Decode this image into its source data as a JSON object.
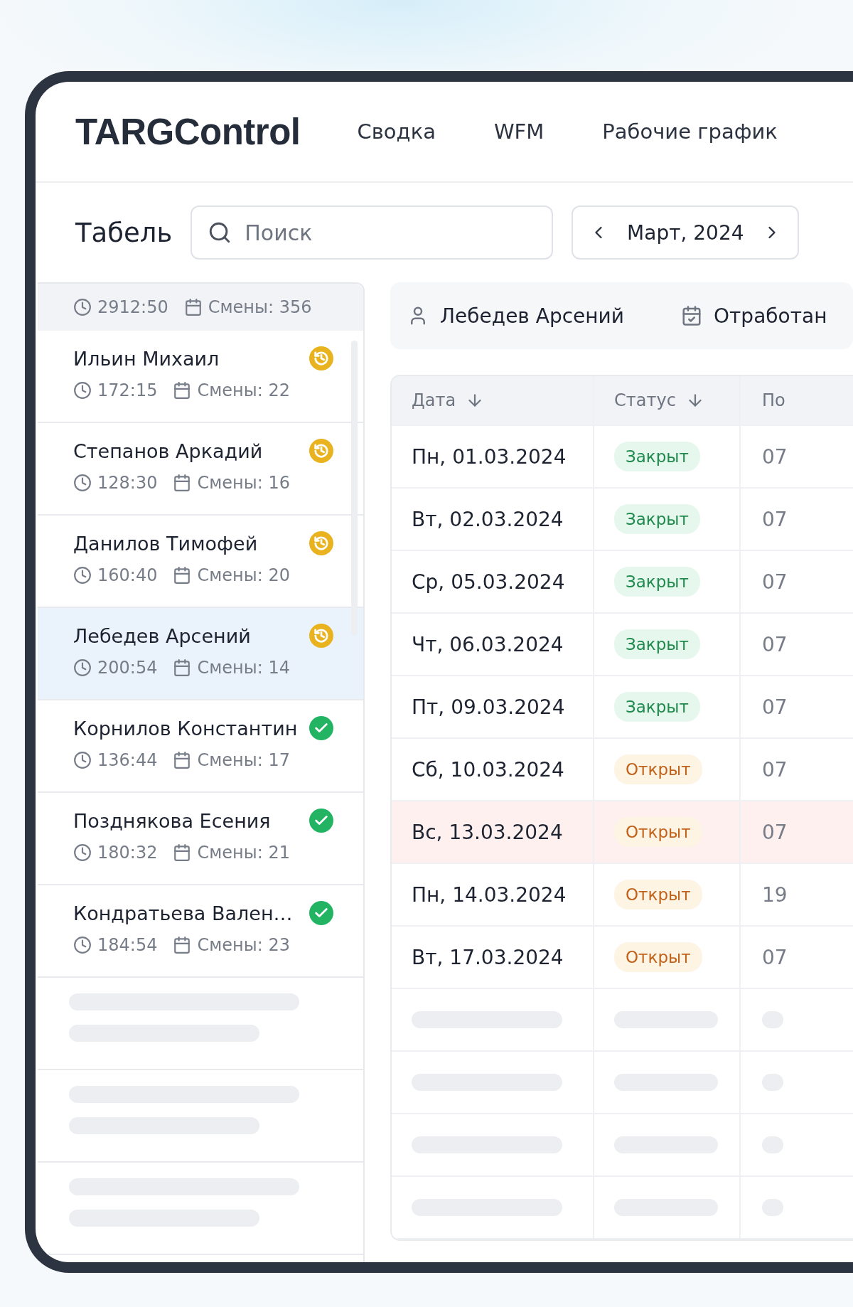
{
  "header": {
    "logo": "TARGControl",
    "nav": [
      "Сводка",
      "WFM",
      "Рабочие график"
    ]
  },
  "toolbar": {
    "title": "Табель",
    "search": {
      "placeholder": "Поиск"
    },
    "month": "Март, 2024"
  },
  "summary": {
    "hours": "2912:50",
    "shifts": "Смены: 356"
  },
  "employees": [
    {
      "name": "Ильин Михаил",
      "hours": "172:15",
      "shifts": "Смены: 22",
      "kind": "pending",
      "selected": false
    },
    {
      "name": "Степанов Аркадий",
      "hours": "128:30",
      "shifts": "Смены: 16",
      "kind": "pending",
      "selected": false
    },
    {
      "name": "Данилов Тимофей",
      "hours": "160:40",
      "shifts": "Смены: 20",
      "kind": "pending",
      "selected": false
    },
    {
      "name": "Лебедев Арсений",
      "hours": "200:54",
      "shifts": "Смены: 14",
      "kind": "pending",
      "selected": true
    },
    {
      "name": "Корнилов Константин",
      "hours": "136:44",
      "shifts": "Смены: 17",
      "kind": "done",
      "selected": false
    },
    {
      "name": "Позднякова Есения",
      "hours": "180:32",
      "shifts": "Смены: 21",
      "kind": "done",
      "selected": false
    },
    {
      "name": "Кондратьева Вален…",
      "hours": "184:54",
      "shifts": "Смены: 23",
      "kind": "done",
      "selected": false
    }
  ],
  "person_bar": {
    "name": "Лебедев Арсений",
    "worked": "Отработан"
  },
  "table": {
    "columns": [
      {
        "label": "Дата",
        "sorted": true
      },
      {
        "label": "Статус",
        "sorted": true
      },
      {
        "label": "По"
      }
    ],
    "rows": [
      {
        "date": "Пн, 01.03.2024",
        "status": {
          "label": "Закрыт",
          "kind": "closed"
        },
        "column_3": "07",
        "highlighted": false
      },
      {
        "date": "Вт, 02.03.2024",
        "status": {
          "label": "Закрыт",
          "kind": "closed"
        },
        "column_3": "07",
        "highlighted": false
      },
      {
        "date": "Ср, 05.03.2024",
        "status": {
          "label": "Закрыт",
          "kind": "closed"
        },
        "column_3": "07",
        "highlighted": false
      },
      {
        "date": "Чт, 06.03.2024",
        "status": {
          "label": "Закрыт",
          "kind": "closed"
        },
        "column_3": "07",
        "highlighted": false
      },
      {
        "date": "Пт, 09.03.2024",
        "status": {
          "label": "Закрыт",
          "kind": "closed"
        },
        "column_3": "07",
        "highlighted": false
      },
      {
        "date": "Сб, 10.03.2024",
        "status": {
          "label": "Открыт",
          "kind": "open"
        },
        "column_3": "07",
        "highlighted": false
      },
      {
        "date": "Вс, 13.03.2024",
        "status": {
          "label": "Открыт",
          "kind": "open"
        },
        "column_3": "07",
        "highlighted": true
      },
      {
        "date": "Пн, 14.03.2024",
        "status": {
          "label": "Открыт",
          "kind": "open"
        },
        "column_3": "19",
        "highlighted": false
      },
      {
        "date": "Вт, 17.03.2024",
        "status": {
          "label": "Открыт",
          "kind": "open"
        },
        "column_3": "07",
        "highlighted": false
      }
    ]
  }
}
